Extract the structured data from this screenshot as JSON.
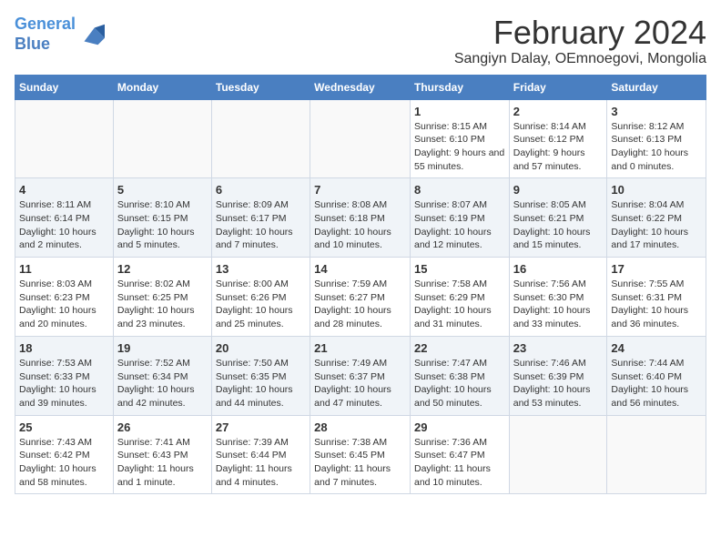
{
  "logo": {
    "line1": "General",
    "line2": "Blue"
  },
  "title": "February 2024",
  "subtitle": "Sangiyn Dalay, OEmnoegovi, Mongolia",
  "headers": [
    "Sunday",
    "Monday",
    "Tuesday",
    "Wednesday",
    "Thursday",
    "Friday",
    "Saturday"
  ],
  "weeks": [
    [
      {
        "day": "",
        "info": ""
      },
      {
        "day": "",
        "info": ""
      },
      {
        "day": "",
        "info": ""
      },
      {
        "day": "",
        "info": ""
      },
      {
        "day": "1",
        "info": "Sunrise: 8:15 AM\nSunset: 6:10 PM\nDaylight: 9 hours and 55 minutes."
      },
      {
        "day": "2",
        "info": "Sunrise: 8:14 AM\nSunset: 6:12 PM\nDaylight: 9 hours and 57 minutes."
      },
      {
        "day": "3",
        "info": "Sunrise: 8:12 AM\nSunset: 6:13 PM\nDaylight: 10 hours and 0 minutes."
      }
    ],
    [
      {
        "day": "4",
        "info": "Sunrise: 8:11 AM\nSunset: 6:14 PM\nDaylight: 10 hours and 2 minutes."
      },
      {
        "day": "5",
        "info": "Sunrise: 8:10 AM\nSunset: 6:15 PM\nDaylight: 10 hours and 5 minutes."
      },
      {
        "day": "6",
        "info": "Sunrise: 8:09 AM\nSunset: 6:17 PM\nDaylight: 10 hours and 7 minutes."
      },
      {
        "day": "7",
        "info": "Sunrise: 8:08 AM\nSunset: 6:18 PM\nDaylight: 10 hours and 10 minutes."
      },
      {
        "day": "8",
        "info": "Sunrise: 8:07 AM\nSunset: 6:19 PM\nDaylight: 10 hours and 12 minutes."
      },
      {
        "day": "9",
        "info": "Sunrise: 8:05 AM\nSunset: 6:21 PM\nDaylight: 10 hours and 15 minutes."
      },
      {
        "day": "10",
        "info": "Sunrise: 8:04 AM\nSunset: 6:22 PM\nDaylight: 10 hours and 17 minutes."
      }
    ],
    [
      {
        "day": "11",
        "info": "Sunrise: 8:03 AM\nSunset: 6:23 PM\nDaylight: 10 hours and 20 minutes."
      },
      {
        "day": "12",
        "info": "Sunrise: 8:02 AM\nSunset: 6:25 PM\nDaylight: 10 hours and 23 minutes."
      },
      {
        "day": "13",
        "info": "Sunrise: 8:00 AM\nSunset: 6:26 PM\nDaylight: 10 hours and 25 minutes."
      },
      {
        "day": "14",
        "info": "Sunrise: 7:59 AM\nSunset: 6:27 PM\nDaylight: 10 hours and 28 minutes."
      },
      {
        "day": "15",
        "info": "Sunrise: 7:58 AM\nSunset: 6:29 PM\nDaylight: 10 hours and 31 minutes."
      },
      {
        "day": "16",
        "info": "Sunrise: 7:56 AM\nSunset: 6:30 PM\nDaylight: 10 hours and 33 minutes."
      },
      {
        "day": "17",
        "info": "Sunrise: 7:55 AM\nSunset: 6:31 PM\nDaylight: 10 hours and 36 minutes."
      }
    ],
    [
      {
        "day": "18",
        "info": "Sunrise: 7:53 AM\nSunset: 6:33 PM\nDaylight: 10 hours and 39 minutes."
      },
      {
        "day": "19",
        "info": "Sunrise: 7:52 AM\nSunset: 6:34 PM\nDaylight: 10 hours and 42 minutes."
      },
      {
        "day": "20",
        "info": "Sunrise: 7:50 AM\nSunset: 6:35 PM\nDaylight: 10 hours and 44 minutes."
      },
      {
        "day": "21",
        "info": "Sunrise: 7:49 AM\nSunset: 6:37 PM\nDaylight: 10 hours and 47 minutes."
      },
      {
        "day": "22",
        "info": "Sunrise: 7:47 AM\nSunset: 6:38 PM\nDaylight: 10 hours and 50 minutes."
      },
      {
        "day": "23",
        "info": "Sunrise: 7:46 AM\nSunset: 6:39 PM\nDaylight: 10 hours and 53 minutes."
      },
      {
        "day": "24",
        "info": "Sunrise: 7:44 AM\nSunset: 6:40 PM\nDaylight: 10 hours and 56 minutes."
      }
    ],
    [
      {
        "day": "25",
        "info": "Sunrise: 7:43 AM\nSunset: 6:42 PM\nDaylight: 10 hours and 58 minutes."
      },
      {
        "day": "26",
        "info": "Sunrise: 7:41 AM\nSunset: 6:43 PM\nDaylight: 11 hours and 1 minute."
      },
      {
        "day": "27",
        "info": "Sunrise: 7:39 AM\nSunset: 6:44 PM\nDaylight: 11 hours and 4 minutes."
      },
      {
        "day": "28",
        "info": "Sunrise: 7:38 AM\nSunset: 6:45 PM\nDaylight: 11 hours and 7 minutes."
      },
      {
        "day": "29",
        "info": "Sunrise: 7:36 AM\nSunset: 6:47 PM\nDaylight: 11 hours and 10 minutes."
      },
      {
        "day": "",
        "info": ""
      },
      {
        "day": "",
        "info": ""
      }
    ]
  ]
}
